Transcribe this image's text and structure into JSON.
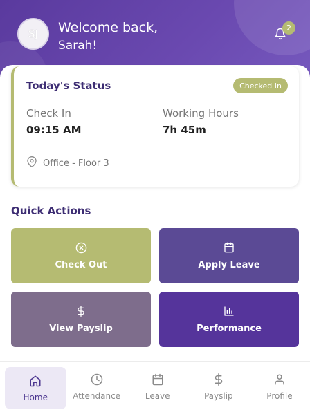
{
  "header": {
    "avatar_initials": "SJ",
    "greeting_line1": "Welcome back,",
    "greeting_line2": "Sarah!",
    "notification_count": "2"
  },
  "status": {
    "title": "Today's Status",
    "badge": "Checked In",
    "check_in_label": "Check In",
    "check_in_value": "09:15 AM",
    "hours_label": "Working Hours",
    "hours_value": "7h 45m",
    "location": "Office - Floor 3"
  },
  "quick_actions": {
    "title": "Quick Actions",
    "items": [
      {
        "label": "Check Out",
        "icon": "x-circle-icon",
        "color": "#b5bb72"
      },
      {
        "label": "Apply Leave",
        "icon": "calendar-icon",
        "color": "#5b4a95"
      },
      {
        "label": "View Payslip",
        "icon": "dollar-icon",
        "color": "#7e6d8c"
      },
      {
        "label": "Performance",
        "icon": "bar-chart-icon",
        "color": "#55349b"
      }
    ]
  },
  "nav": {
    "items": [
      {
        "label": "Home",
        "icon": "home-icon",
        "active": true
      },
      {
        "label": "Attendance",
        "icon": "clock-icon"
      },
      {
        "label": "Leave",
        "icon": "calendar-icon"
      },
      {
        "label": "Payslip",
        "icon": "dollar-icon"
      },
      {
        "label": "Profile",
        "icon": "user-icon"
      }
    ]
  },
  "colors": {
    "brand": "#5a3a9e",
    "accent": "#b5bb72",
    "title": "#3d2d73"
  }
}
